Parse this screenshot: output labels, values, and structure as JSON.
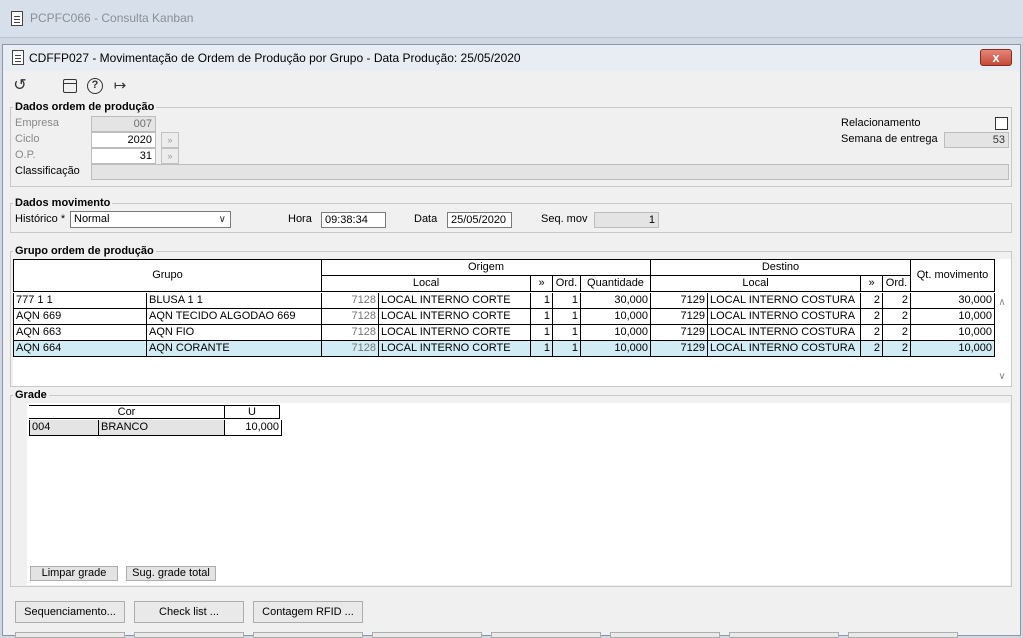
{
  "outer_window": {
    "title": "PCPFC066 - Consulta Kanban"
  },
  "window": {
    "title": "CDFFP027 - Movimentação de Ordem de Produção por Grupo - Data Produção: 25/05/2020",
    "close_label": "x"
  },
  "toolbar": {
    "icons": [
      "undo-icon",
      "calendar-icon",
      "help-icon",
      "exit-icon"
    ]
  },
  "dados_ordem": {
    "label": "Dados ordem de produção",
    "empresa_label": "Empresa",
    "empresa_value": "007",
    "ciclo_label": "Ciclo",
    "ciclo_value": "2020",
    "op_label": "O.P.",
    "op_value": "31",
    "classificacao_label": "Classificação",
    "classificacao_value": "",
    "relacionamento_label": "Relacionamento",
    "semana_label": "Semana de entrega",
    "semana_value": "53"
  },
  "dados_movimento": {
    "label": "Dados movimento",
    "historico_label": "Histórico *",
    "historico_value": "Normal",
    "hora_label": "Hora",
    "hora_value": "09:38:34",
    "data_label": "Data",
    "data_value": "25/05/2020",
    "seq_label": "Seq. mov",
    "seq_value": "1"
  },
  "grupo_ordem": {
    "label": "Grupo ordem de produção",
    "headers": {
      "grupo": "Grupo",
      "origem": "Origem",
      "destino": "Destino",
      "local": "Local",
      "arrows": "»",
      "ord": "Ord.",
      "quantidade": "Quantidade",
      "local_dest": "Local",
      "arrows_dest": "»",
      "ord_dest": "Ord.",
      "qt_mov": "Qt. movimento"
    },
    "rows": [
      {
        "code": "777 1 1",
        "desc": "BLUSA 1 1",
        "orig_num": "7128",
        "orig_local": "LOCAL INTERNO CORTE",
        "orig_a": "1",
        "orig_ord": "1",
        "qtd": "30,000",
        "dest_num": "7129",
        "dest_local": "LOCAL INTERNO COSTURA",
        "dest_a": "2",
        "dest_ord": "2",
        "qt_mov": "30,000"
      },
      {
        "code": "AQN 669",
        "desc": "AQN TECIDO ALGODAO 669",
        "orig_num": "7128",
        "orig_local": "LOCAL INTERNO CORTE",
        "orig_a": "1",
        "orig_ord": "1",
        "qtd": "10,000",
        "dest_num": "7129",
        "dest_local": "LOCAL INTERNO COSTURA",
        "dest_a": "2",
        "dest_ord": "2",
        "qt_mov": "10,000"
      },
      {
        "code": "AQN 663",
        "desc": "AQN FIO",
        "orig_num": "7128",
        "orig_local": "LOCAL INTERNO CORTE",
        "orig_a": "1",
        "orig_ord": "1",
        "qtd": "10,000",
        "dest_num": "7129",
        "dest_local": "LOCAL INTERNO COSTURA",
        "dest_a": "2",
        "dest_ord": "2",
        "qt_mov": "10,000"
      },
      {
        "code": "AQN 664",
        "desc": "AQN CORANTE",
        "orig_num": "7128",
        "orig_local": "LOCAL INTERNO CORTE",
        "orig_a": "1",
        "orig_ord": "1",
        "qtd": "10,000",
        "dest_num": "7129",
        "dest_local": "LOCAL INTERNO COSTURA",
        "dest_a": "2",
        "dest_ord": "2",
        "qt_mov": "10,000"
      }
    ]
  },
  "grade": {
    "label": "Grade",
    "headers": {
      "cor": "Cor",
      "u": "U"
    },
    "rows": [
      {
        "code": "004",
        "cor": "BRANCO",
        "u": "10,000"
      }
    ],
    "limpar_label": "Limpar grade",
    "sug_label": "Sug. grade total"
  },
  "bottom_buttons": {
    "sequenciamento": "Sequenciamento...",
    "checklist": "Check list ...",
    "contagem": "Contagem RFID ..."
  },
  "colors": {
    "selected_row": "#d2ecf5",
    "close": "#c44a36"
  }
}
